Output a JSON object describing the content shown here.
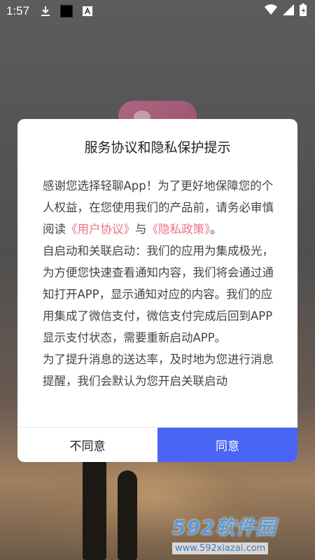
{
  "status_bar": {
    "time": "1:57",
    "icons": [
      "download-icon",
      "square-notification-icon",
      "text-a-icon",
      "wifi-icon",
      "signal-icon",
      "battery-icon"
    ]
  },
  "dialog": {
    "title": "服务协议和隐私保护提示",
    "intro_text": "感谢您选择轻聊App！为了更好地保障您的个人权益，在您使用我们的产品前，请务必审慎阅读",
    "user_agreement_link": "《用户协议》",
    "and_text": "与",
    "privacy_policy_link": "《隐私政策》",
    "intro_end": "。",
    "para_autostart": "自启动和关联启动：我们的应用为集成极光，为方便您快速查看通知内容，我们将会通过通知打开APP，显示通知对应的内容。我们的应用集成了微信支付，微信支付完成后回到APP显示支付状态，需要重新启动APP。",
    "para_push": "为了提升消息的送达率，及时地为您进行消息提醒，我们会默认为您开启关联启动",
    "decline_label": "不同意",
    "accept_label": "同意"
  },
  "watermark": {
    "brand": "592软件园",
    "url": "www.592xiazai.com"
  },
  "colors": {
    "accent": "#4a64f5",
    "link": "#ee6f88",
    "dialog_bg": "#ffffff",
    "overlay_bg": "#4f4f4f"
  }
}
